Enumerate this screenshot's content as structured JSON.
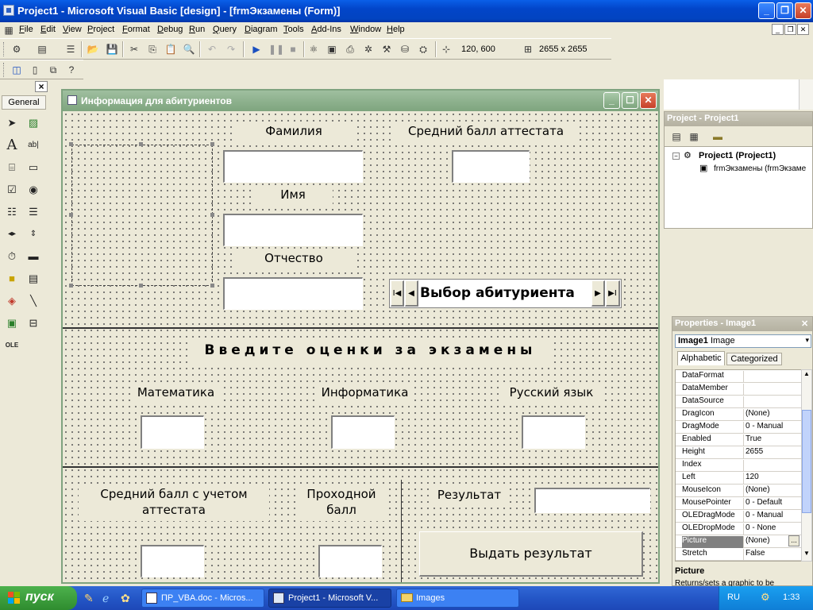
{
  "window": {
    "title": "Project1 - Microsoft Visual Basic [design] - [frmЭкзамены (Form)]"
  },
  "menu": {
    "items": [
      "File",
      "Edit",
      "View",
      "Project",
      "Format",
      "Debug",
      "Run",
      "Query",
      "Diagram",
      "Tools",
      "Add-Ins",
      "Window",
      "Help"
    ]
  },
  "toolbar": {
    "position": "120, 600",
    "size": "2655 x 2655"
  },
  "toolbox": {
    "close": "×",
    "tab": "General"
  },
  "form": {
    "title": "Информация для абитуриентов",
    "labels": {
      "surname": "Фамилия",
      "name": "Имя",
      "patronymic": "Отчество",
      "avg_certificate": "Средний балл аттестата",
      "exams_header": "Введите оценки за экзамены",
      "math": "Математика",
      "informatics": "Информатика",
      "russian": "Русский язык",
      "avg_with_cert_1": "Средний балл с учетом",
      "avg_with_cert_2": "аттестата",
      "pass_score_1": "Проходной",
      "pass_score_2": "балл",
      "result": "Результат"
    },
    "navigator": {
      "caption": "Выбор абитуриента",
      "first": "I◀",
      "prev": "◀",
      "next": "▶",
      "last": "▶I"
    },
    "button_result": "Выдать результат"
  },
  "project_pane": {
    "title": "Project - Project1",
    "root": "Project1 (Project1)",
    "child": "frmЭкзамены (frmЭкзаме"
  },
  "properties_pane": {
    "title": "Properties - Image1",
    "object": "Image1",
    "object_type": "Image",
    "tabs": [
      "Alphabetic",
      "Categorized"
    ],
    "rows": [
      {
        "name": "DataFormat",
        "value": ""
      },
      {
        "name": "DataMember",
        "value": ""
      },
      {
        "name": "DataSource",
        "value": ""
      },
      {
        "name": "DragIcon",
        "value": "(None)"
      },
      {
        "name": "DragMode",
        "value": "0 - Manual"
      },
      {
        "name": "Enabled",
        "value": "True"
      },
      {
        "name": "Height",
        "value": "2655"
      },
      {
        "name": "Index",
        "value": ""
      },
      {
        "name": "Left",
        "value": "120"
      },
      {
        "name": "MouseIcon",
        "value": "(None)"
      },
      {
        "name": "MousePointer",
        "value": "0 - Default"
      },
      {
        "name": "OLEDragMode",
        "value": "0 - Manual"
      },
      {
        "name": "OLEDropMode",
        "value": "0 - None"
      },
      {
        "name": "Picture",
        "value": "(None)"
      },
      {
        "name": "Stretch",
        "value": "False"
      }
    ],
    "desc_title": "Picture",
    "desc_text": "Returns/sets a graphic to be"
  },
  "taskbar": {
    "start": "пуск",
    "tasks": [
      "ПР_VBA.doc - Micros...",
      "Project1 - Microsoft V...",
      "Images"
    ],
    "lang": "RU",
    "clock": "1:33"
  }
}
